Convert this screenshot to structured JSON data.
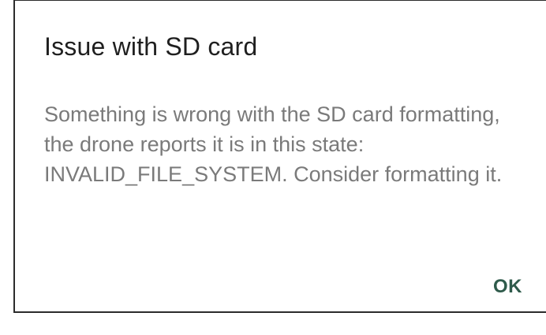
{
  "dialog": {
    "title": "Issue with SD card",
    "message": "Something is wrong with the SD card formatting, the drone reports it is in this state: INVALID_FILE_SYSTEM. Consider formatting it.",
    "ok_label": "OK"
  },
  "colors": {
    "title": "#1f1f1f",
    "message": "#7a7a7a",
    "accent": "#2f5b4b",
    "background": "#ffffff"
  }
}
